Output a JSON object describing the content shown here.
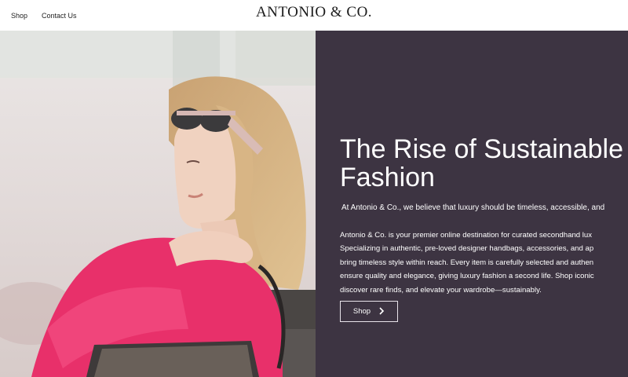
{
  "nav": {
    "items": [
      "Shop",
      "Contact Us"
    ]
  },
  "brand": {
    "logo": "ANTONIO & CO."
  },
  "hero": {
    "headline_line1": "The Rise of Sustainable",
    "headline_line2": "Fashion",
    "lead": "At Antonio & Co., we believe that luxury should be timeless, accessible, and",
    "body_lines": [
      "Antonio & Co. is your premier online destination for curated secondhand lux",
      "Specializing in authentic, pre-loved designer handbags, accessories, and ap",
      "bring timeless style within reach. Every item is carefully selected and authen",
      "ensure quality and elegance, giving luxury fashion a second life. Shop iconic",
      "discover rare finds, and elevate your wardrobe—sustainably."
    ],
    "cta_label": "Shop",
    "cta_icon": "chevron-right-icon"
  },
  "colors": {
    "panel_bg": "#3d3442",
    "text_on_panel": "#ffffff",
    "jacket": "#e8306a"
  }
}
